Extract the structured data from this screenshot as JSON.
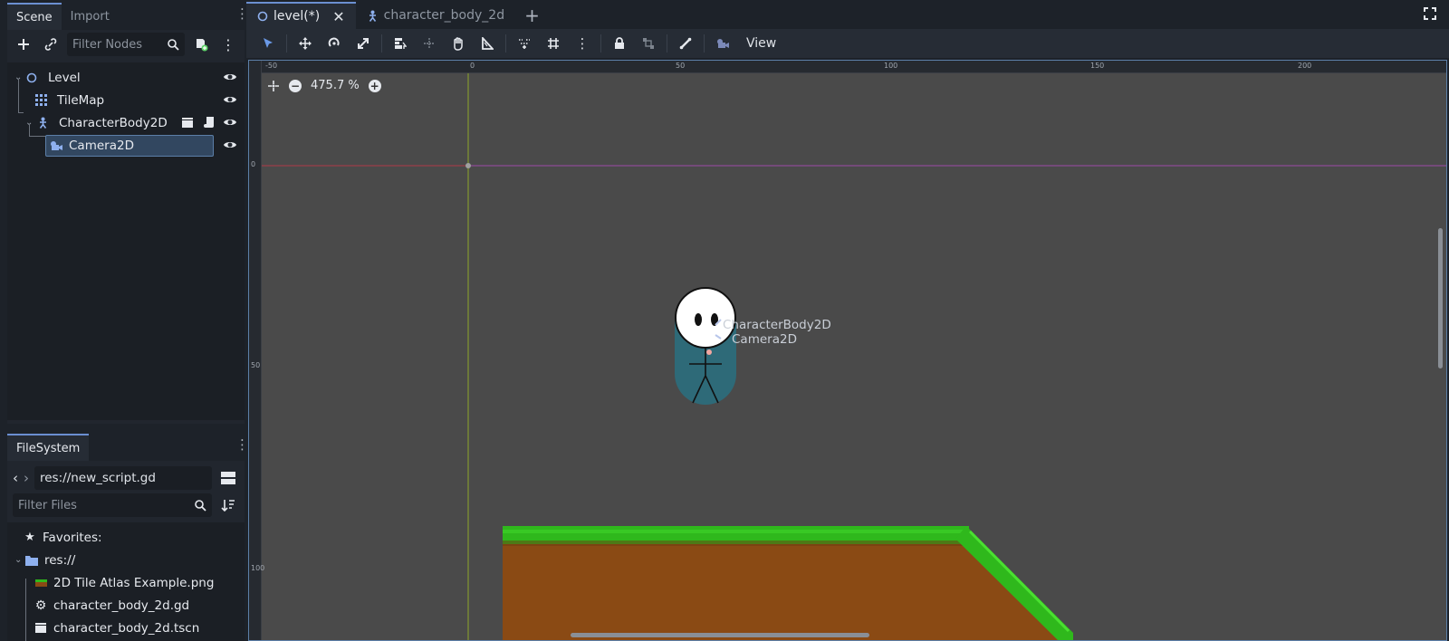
{
  "left_dock": {
    "scene_tab": "Scene",
    "import_tab": "Import",
    "filter_nodes_placeholder": "Filter Nodes",
    "tree": [
      {
        "label": "Level"
      },
      {
        "label": "TileMap"
      },
      {
        "label": "CharacterBody2D"
      },
      {
        "label": "Camera2D"
      }
    ]
  },
  "filesystem": {
    "tab": "FileSystem",
    "path": "res://new_script.gd",
    "filter_placeholder": "Filter Files",
    "favorites": "Favorites:",
    "items": [
      {
        "label": "res://"
      },
      {
        "label": "2D Tile Atlas Example.png"
      },
      {
        "label": "character_body_2d.gd"
      },
      {
        "label": "character_body_2d.tscn"
      }
    ]
  },
  "editor": {
    "tabs": [
      {
        "label": "level(*)"
      },
      {
        "label": "character_body_2d"
      }
    ],
    "view_menu": "View",
    "zoom_level": "475.7 %",
    "ruler_top": [
      "-50",
      "0",
      "50",
      "100",
      "150",
      "200"
    ],
    "ruler_left": [
      "0",
      "50",
      "100"
    ],
    "viewport_labels": [
      "CharacterBody2D",
      "Camera2D"
    ]
  },
  "colors": {
    "accent": "#6b8fd1",
    "viewport_bg": "#4a4a4a",
    "grass": "#2fb81c",
    "dirt": "#8a4a14",
    "capsule": "#2c6b7a"
  }
}
